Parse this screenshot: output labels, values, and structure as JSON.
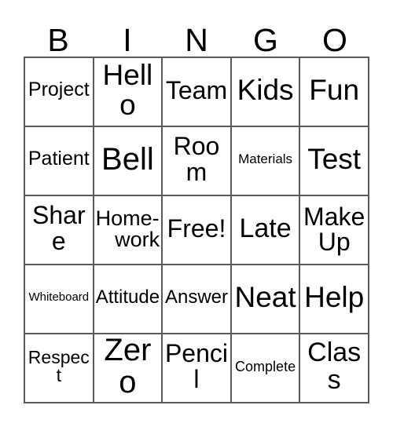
{
  "card": {
    "title": "Bingo Card",
    "header_letters": [
      "B",
      "I",
      "N",
      "G",
      "O"
    ],
    "free_space_label": "Free!",
    "colors": {
      "background": "#ffffff",
      "text": "#000000",
      "gridline": "#5a5a5a"
    },
    "grid_size": "5x5",
    "rows": [
      {
        "cells": [
          {
            "label": "Project",
            "font_size": 25,
            "lines": [
              "Project"
            ]
          },
          {
            "label": "Hello",
            "font_size": 37,
            "lines": [
              "Hello"
            ]
          },
          {
            "label": "Team",
            "font_size": 32,
            "lines": [
              "Team"
            ]
          },
          {
            "label": "Kids",
            "font_size": 37,
            "lines": [
              "Kids"
            ]
          },
          {
            "label": "Fun",
            "font_size": 37,
            "lines": [
              "Fun"
            ]
          }
        ]
      },
      {
        "cells": [
          {
            "label": "Patient",
            "font_size": 25,
            "lines": [
              "Patient"
            ]
          },
          {
            "label": "Bell",
            "font_size": 40,
            "lines": [
              "Bell"
            ]
          },
          {
            "label": "Room",
            "font_size": 32,
            "lines": [
              "Room"
            ]
          },
          {
            "label": "Materials",
            "font_size": 17,
            "lines": [
              "Materials"
            ]
          },
          {
            "label": "Test",
            "font_size": 37,
            "lines": [
              "Test"
            ]
          }
        ]
      },
      {
        "cells": [
          {
            "label": "Share",
            "font_size": 32,
            "lines": [
              "Share"
            ]
          },
          {
            "label": "Home-work",
            "font_size": 27,
            "lines": [
              "Home-",
              "work"
            ],
            "align": [
              "left",
              "right"
            ]
          },
          {
            "label": "Free!",
            "font_size": 32,
            "lines": [
              "Free!"
            ]
          },
          {
            "label": "Late",
            "font_size": 34,
            "lines": [
              "Late"
            ]
          },
          {
            "label": "Make Up",
            "font_size": 32,
            "lines": [
              "Make",
              "Up"
            ],
            "align": [
              "center",
              "center"
            ]
          }
        ]
      },
      {
        "cells": [
          {
            "label": "Whiteboard",
            "font_size": 15,
            "lines": [
              "Whiteboard"
            ]
          },
          {
            "label": "Attitude",
            "font_size": 24,
            "lines": [
              "Attitude"
            ]
          },
          {
            "label": "Answer",
            "font_size": 24,
            "lines": [
              "Answer"
            ]
          },
          {
            "label": "Neat",
            "font_size": 37,
            "lines": [
              "Neat"
            ]
          },
          {
            "label": "Help",
            "font_size": 37,
            "lines": [
              "Help"
            ]
          }
        ]
      },
      {
        "cells": [
          {
            "label": "Respect",
            "font_size": 23,
            "lines": [
              "Respect"
            ]
          },
          {
            "label": "Zero",
            "font_size": 40,
            "lines": [
              "Zero"
            ]
          },
          {
            "label": "Pencil",
            "font_size": 32,
            "lines": [
              "Pencil"
            ]
          },
          {
            "label": "Complete",
            "font_size": 18,
            "lines": [
              "Complete"
            ]
          },
          {
            "label": "Class",
            "font_size": 34,
            "lines": [
              "Class"
            ]
          }
        ]
      }
    ]
  }
}
